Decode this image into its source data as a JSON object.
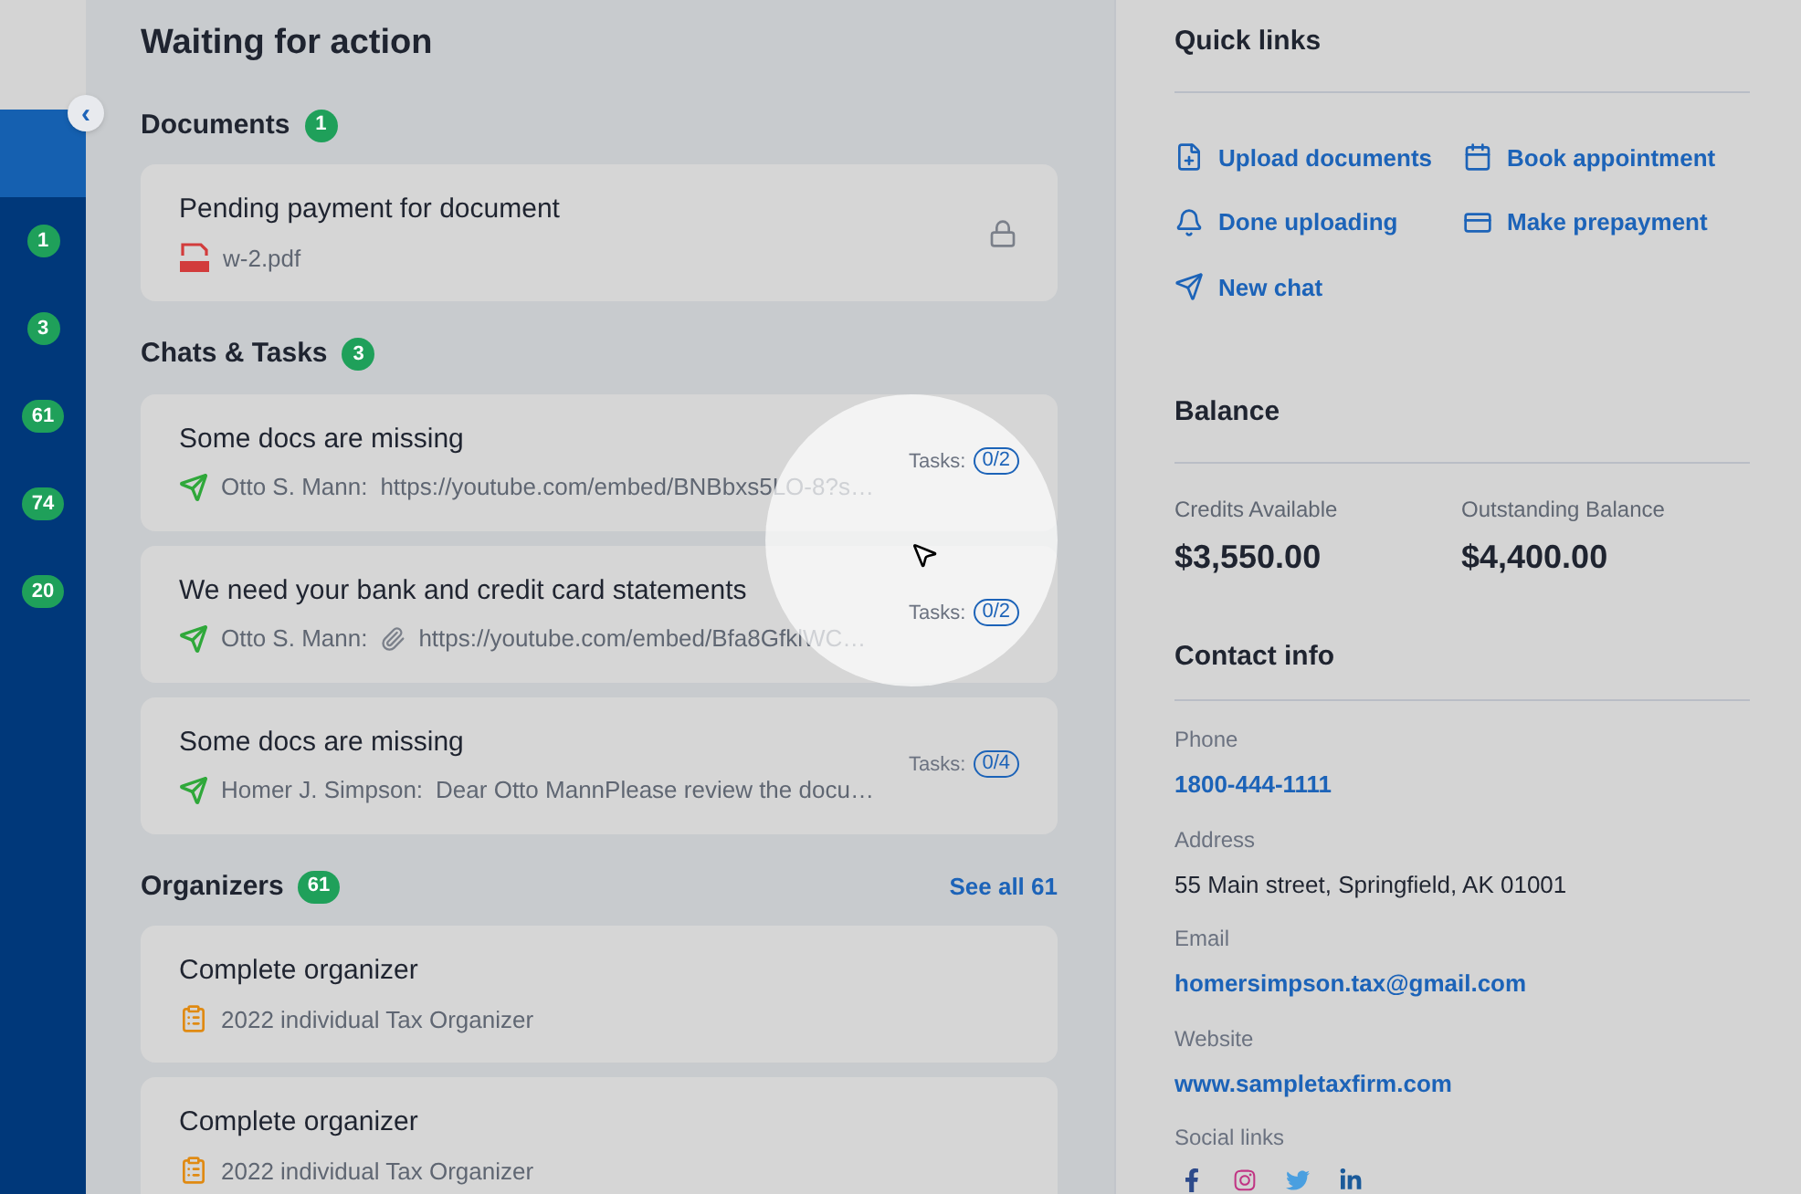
{
  "sidebar": {
    "collapse_button": "‹",
    "items": [
      {
        "selected": true
      },
      {
        "selected": false,
        "badge": "1"
      },
      {
        "selected": false,
        "badge": "3"
      },
      {
        "selected": false,
        "badge": "61"
      },
      {
        "selected": false,
        "badge": "74"
      },
      {
        "selected": false,
        "badge": "20"
      }
    ]
  },
  "main": {
    "title": "Waiting for action",
    "sections": [
      {
        "title": "Documents",
        "count": "1",
        "items": [
          {
            "kind": "document",
            "title": "Pending payment for document",
            "file": "w-2.pdf",
            "locked": true
          }
        ]
      },
      {
        "title": "Chats & Tasks",
        "count": "3",
        "items": [
          {
            "kind": "chat",
            "title": "Some docs are missing",
            "author": "Otto S. Mann:",
            "message": "https://youtube.com/embed/BNBbxs5LO-8?s…",
            "tasks_label": "Tasks:",
            "tasks": "0/2"
          },
          {
            "kind": "chat",
            "title": "We need your bank and credit card statements",
            "author": "Otto S. Mann:",
            "message": "https://youtube.com/embed/Bfa8GfklWC…",
            "attachment": true,
            "tasks_label": "Tasks:",
            "tasks": "0/2"
          },
          {
            "kind": "chat",
            "title": "Some docs are missing",
            "author": "Homer J. Simpson:",
            "message": "Dear Otto MannPlease review the docu…",
            "tasks_label": "Tasks:",
            "tasks": "0/4"
          }
        ]
      },
      {
        "title": "Organizers",
        "count": "61",
        "see_all": "See all 61",
        "items": [
          {
            "kind": "organizer",
            "title": "Complete organizer",
            "subtitle": "2022 individual Tax Organizer"
          },
          {
            "kind": "organizer",
            "title": "Complete organizer",
            "subtitle": "2022 individual Tax Organizer"
          }
        ]
      }
    ]
  },
  "quick_links": {
    "title": "Quick links",
    "links": [
      {
        "kind": "upload",
        "label": "Upload documents"
      },
      {
        "kind": "calendar",
        "label": "Book appointment"
      },
      {
        "kind": "bell",
        "label": "Done uploading"
      },
      {
        "kind": "card",
        "label": "Make prepayment"
      },
      {
        "kind": "send",
        "label": "New chat"
      }
    ]
  },
  "balance": {
    "title": "Balance",
    "items": [
      {
        "label": "Credits Available",
        "value": "$3,550.00"
      },
      {
        "label": "Outstanding Balance",
        "value": "$4,400.00"
      }
    ]
  },
  "contact_info": {
    "title": "Contact info",
    "fields": [
      {
        "label": "Phone",
        "value": "1800-444-1111",
        "kind": "link"
      },
      {
        "label": "Address",
        "value": "55 Main street, Springfield, AK 01001",
        "kind": "text"
      },
      {
        "label": "Email",
        "value": "homersimpson.tax@gmail.com",
        "kind": "link"
      },
      {
        "label": "Website",
        "value": "www.sampletaxfirm.com",
        "kind": "link"
      }
    ],
    "social_label": "Social links",
    "social": [
      {
        "kind": "facebook"
      },
      {
        "kind": "instagram"
      },
      {
        "kind": "twitter"
      },
      {
        "kind": "linkedin"
      }
    ]
  }
}
